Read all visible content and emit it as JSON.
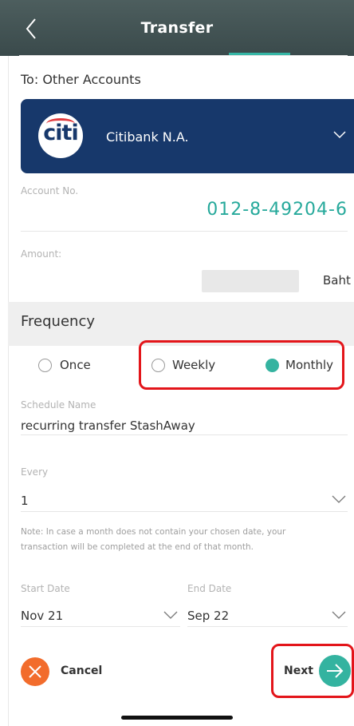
{
  "header": {
    "title": "Transfer"
  },
  "recipient": {
    "to_label": "To: Other Accounts",
    "bank_name": "Citibank N.A.",
    "bank_logo_text": "citi"
  },
  "account": {
    "label": "Account No.",
    "value": "012-8-49204-6"
  },
  "amount": {
    "label": "Amount:",
    "unit": "Baht"
  },
  "frequency": {
    "title": "Frequency",
    "options": [
      {
        "label": "Once",
        "selected": false
      },
      {
        "label": "Weekly",
        "selected": false
      },
      {
        "label": "Monthly",
        "selected": true
      }
    ]
  },
  "schedule": {
    "label": "Schedule Name",
    "value": "recurring transfer StashAway"
  },
  "every": {
    "label": "Every",
    "value": "1"
  },
  "note": "Note: In case a month does not contain your chosen date, your transaction will be completed at the end of that month.",
  "start_date": {
    "label": "Start Date",
    "value": "Nov 21"
  },
  "end_date": {
    "label": "End Date",
    "value": "Sep 22"
  },
  "footer": {
    "cancel_label": "Cancel",
    "next_label": "Next"
  },
  "colors": {
    "accent": "#34b3a0",
    "header": "#44555a",
    "card": "#17386b",
    "cancel": "#f26c2c",
    "highlight": "#e3151a"
  }
}
